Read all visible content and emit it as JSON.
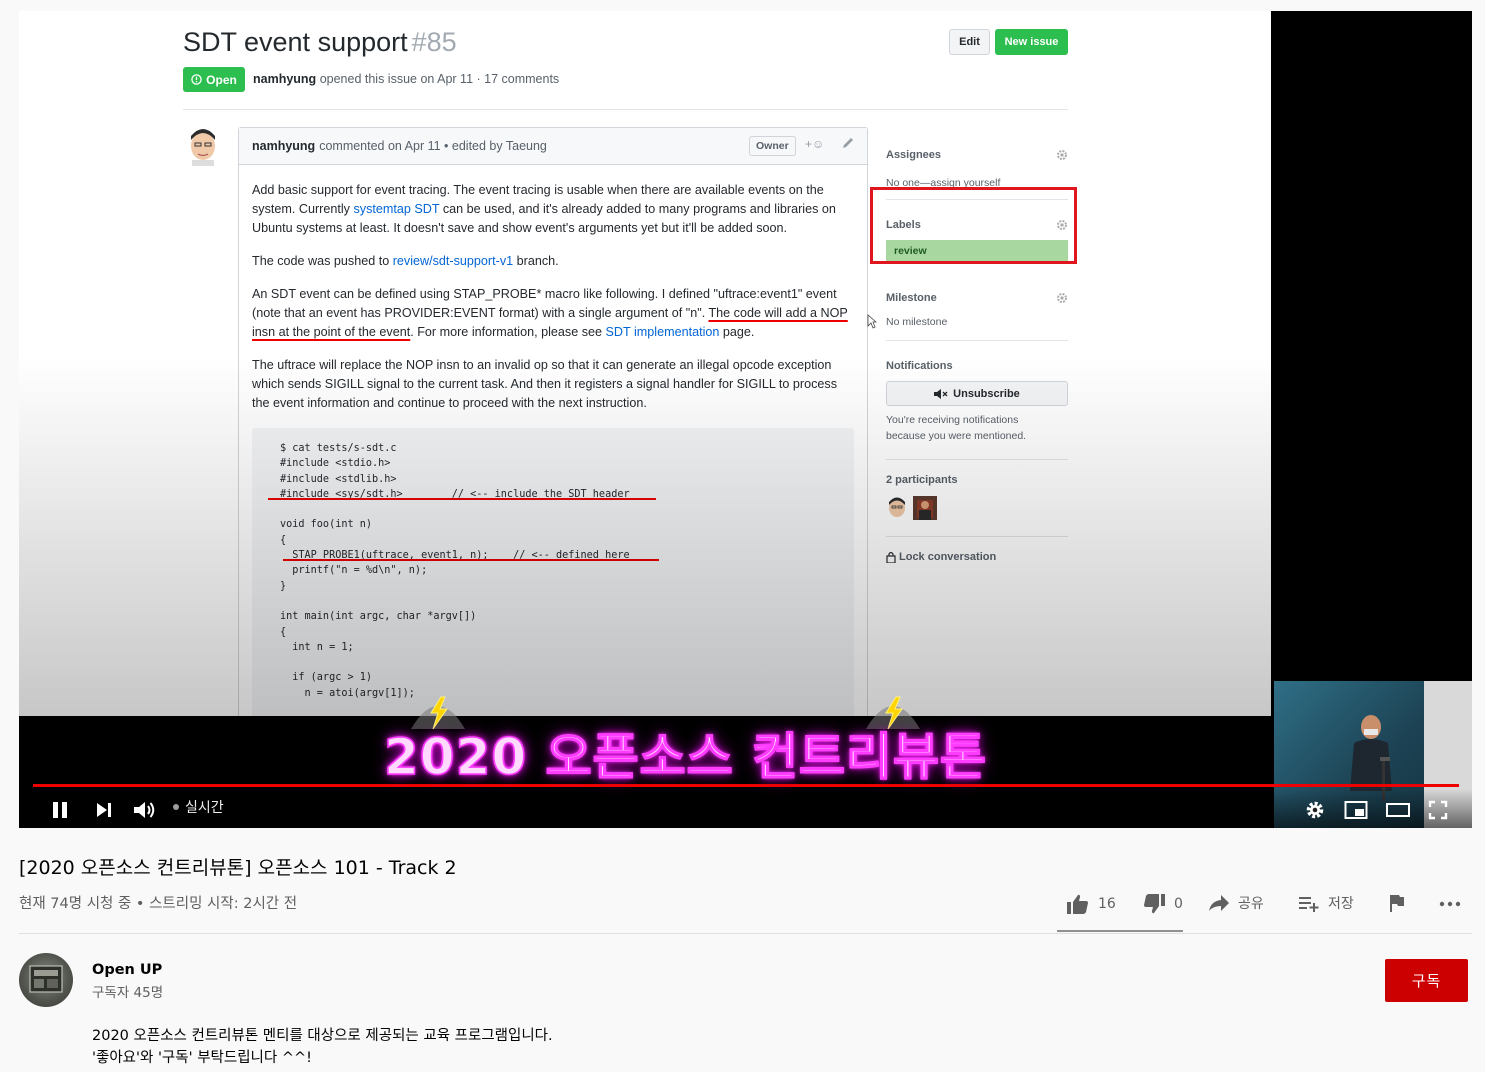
{
  "slide": {
    "issue_title": "SDT event support",
    "issue_number": "#85",
    "edit_label": "Edit",
    "new_issue_label": "New issue",
    "state_label": "Open",
    "author": "namhyung",
    "meta_text": "opened this issue on Apr 11 · 17 comments",
    "comment": {
      "author": "namhyung",
      "header_text": "commented on Apr 11 • edited by Taeung",
      "owner_badge": "Owner",
      "react_label": "+☺",
      "p1_a": "Add basic support for event tracing. The event tracing is usable when there are available events on the system. Currently ",
      "p1_link": "systemtap SDT",
      "p1_b": " can be used, and it's already added to many programs and libraries on Ubuntu systems at least. It doesn't save and show event's arguments yet but it'll be added soon.",
      "p2_a": "The code was pushed to ",
      "p2_link": "review/sdt-support-v1",
      "p2_b": " branch.",
      "p3_a": "An SDT event can be defined using STAP_PROBE* macro like following. I defined \"uftrace:event1\" event (note that an event has PROVIDER:EVENT format) with a single argument of \"n\". ",
      "p3_ul": "The code will add a NOP insn at the point of the event",
      "p3_b": ". For more information, please see ",
      "p3_link": "SDT implementation",
      "p3_c": " page.",
      "p4": "The uftrace will replace the NOP insn to an invalid op so that it can generate an illegal opcode exception which sends SIGILL signal to the current task. And then it registers a signal handler for SIGILL to process the event information and continue to proceed with the next instruction.",
      "code": "$ cat tests/s-sdt.c\n#include <stdio.h>\n#include <stdlib.h>\n#include <sys/sdt.h>        // <-- include the SDT header\n\nvoid foo(int n)\n{\n  STAP_PROBE1(uftrace, event1, n);    // <-- defined here\n  printf(\"n = %d\\n\", n);\n}\n\nint main(int argc, char *argv[])\n{\n  int n = 1;\n\n  if (argc > 1)\n    n = atoi(argv[1]);"
    },
    "sidebar": {
      "assignees_title": "Assignees",
      "assignees_value": "No one—assign yourself",
      "labels_title": "Labels",
      "label_review": "review",
      "milestone_title": "Milestone",
      "milestone_value": "No milestone",
      "notifications_title": "Notifications",
      "unsubscribe_label": "Unsubscribe",
      "notifications_note": "You're receiving notifications because you were mentioned.",
      "participants_title": "2 participants",
      "lock_label": "Lock conversation"
    }
  },
  "overlay": {
    "banner_text": "2020 오픈소스 컨트리뷰톤"
  },
  "player": {
    "live_label": "실시간",
    "progress_fraction": 1.0
  },
  "video": {
    "title": "[2020 오픈소스 컨트리뷰톤] 오픈소스 101 - Track 2",
    "info": "현재 74명 시청 중 • 스트리밍 시작: 2시간 전",
    "likes": "16",
    "dislikes": "0",
    "share_label": "공유",
    "save_label": "저장"
  },
  "channel": {
    "name": "Open UP",
    "subscribers": "구독자 45명",
    "subscribe_label": "구독",
    "description_line1": "2020 오픈소스 컨트리뷰톤 멘티를 대상으로 제공되는 교육 프로그램입니다.",
    "description_line2": "'좋아요'와 '구독' 부탁드립니다 ^^!"
  },
  "colors": {
    "accent_red": "#cc0000",
    "github_green": "#2cbe4e",
    "link_blue": "#0366d6",
    "progress_red": "#ee0000"
  }
}
